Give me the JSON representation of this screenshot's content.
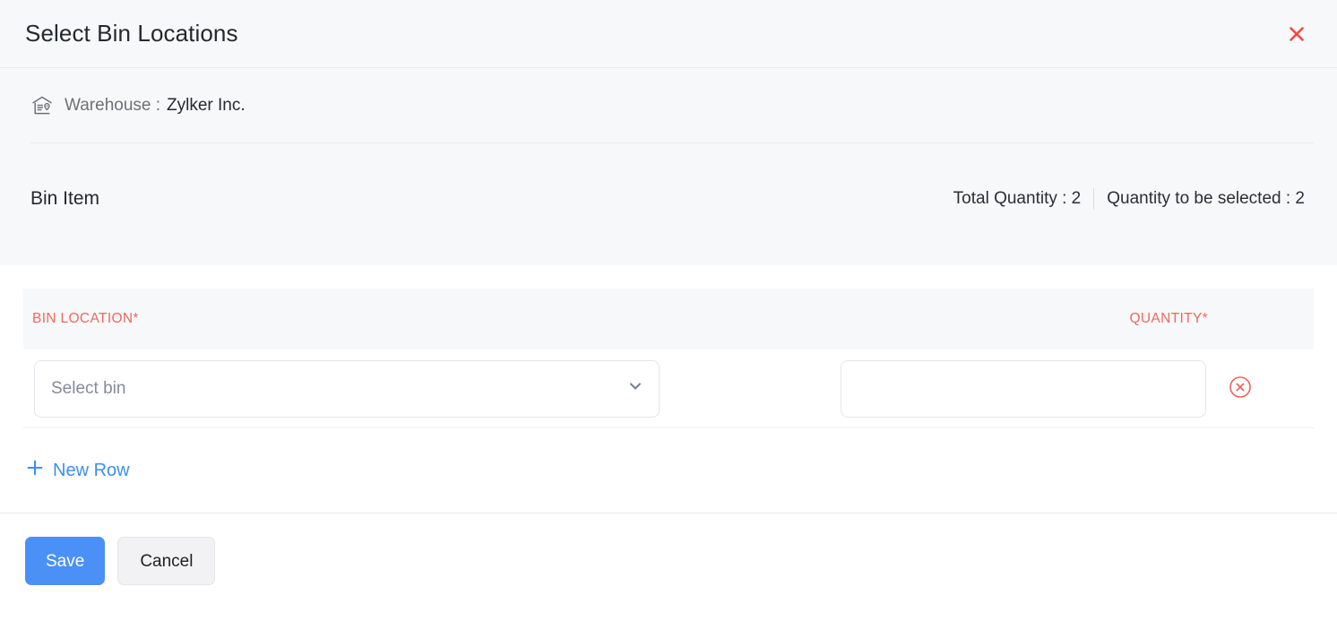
{
  "dialog": {
    "title": "Select Bin Locations",
    "close_icon": "close-icon"
  },
  "warehouse": {
    "icon": "warehouse-icon",
    "label": "Warehouse :",
    "value": "Zylker Inc."
  },
  "item_summary": {
    "title": "Bin Item",
    "total_quantity": "Total Quantity : 2",
    "quantity_to_be_selected": "Quantity to be selected : 2"
  },
  "table": {
    "columns": [
      {
        "key": "bin_location",
        "label": "BIN LOCATION*"
      },
      {
        "key": "quantity",
        "label": "QUANTITY*"
      }
    ],
    "rows": [
      {
        "bin_location_value": "",
        "bin_location_placeholder": "Select bin",
        "quantity_value": "",
        "quantity_placeholder": "",
        "dropdown_icon": "chevron-down-icon",
        "remove_icon": "remove-circle-icon"
      }
    ],
    "add_row_label": "New Row",
    "add_row_icon": "plus-icon"
  },
  "footer": {
    "save_label": "Save",
    "cancel_label": "Cancel"
  },
  "colors": {
    "accent_blue": "#4a90f7",
    "required_red": "#ee6a5f",
    "close_red": "#f9453e",
    "panel_gray": "#f7f8fa",
    "border_gray": "#e9eaee"
  }
}
